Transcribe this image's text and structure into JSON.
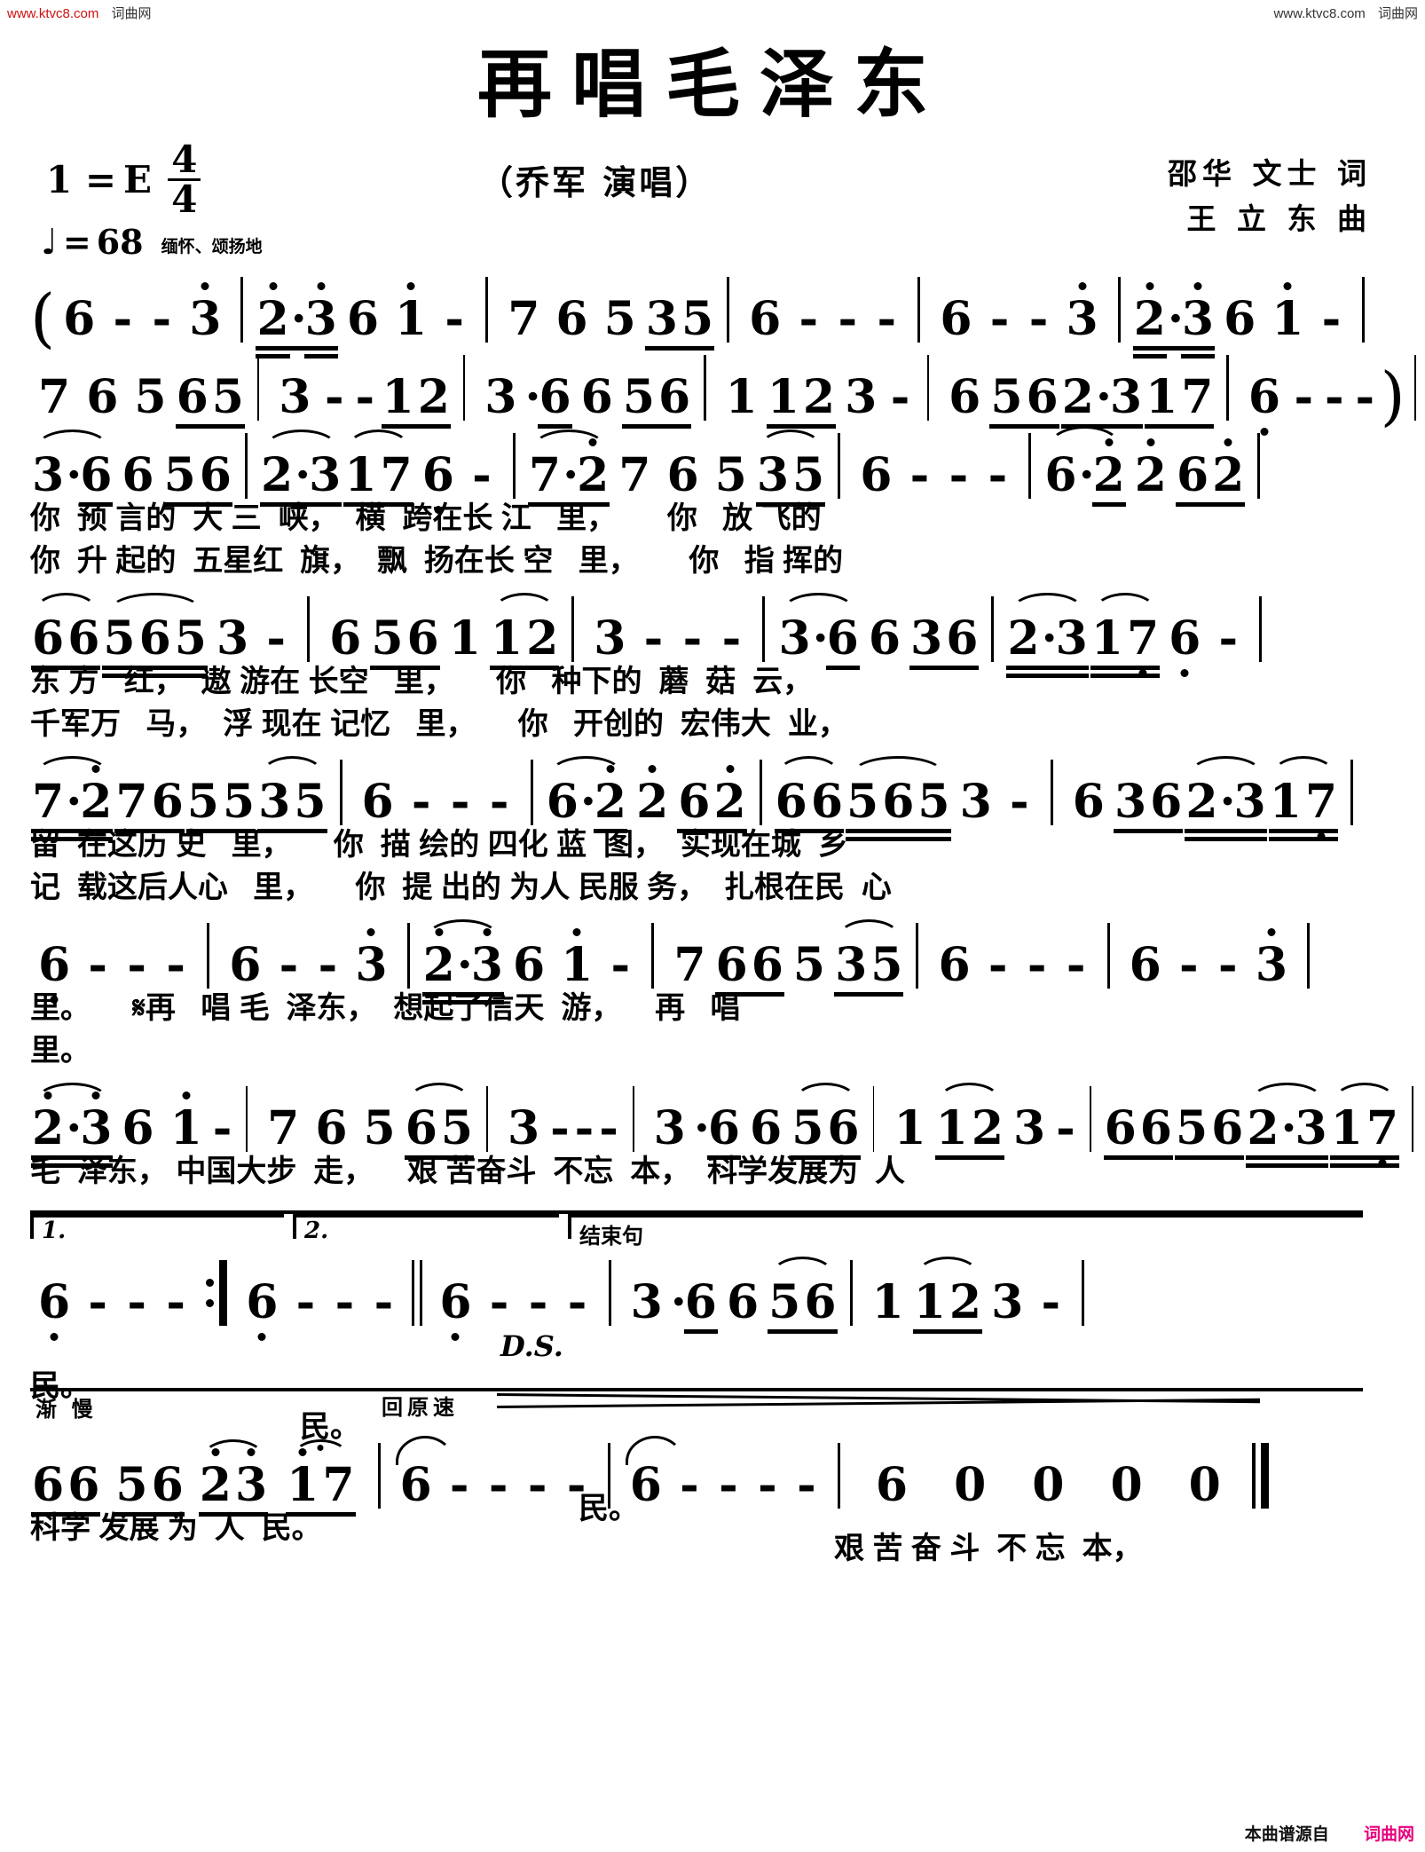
{
  "watermark": {
    "left_url": "www.ktvc8.com",
    "left_site": "词曲网",
    "right_url": "www.ktvc8.com",
    "right_site": "词曲网"
  },
  "footer": {
    "source_label": "本曲谱源自",
    "source_site": "词曲网"
  },
  "header": {
    "title": "再唱毛泽东",
    "key_label": "1 =",
    "key_value": "E",
    "time_numerator": "4",
    "time_denominator": "4",
    "tempo_note": "♩",
    "tempo_eq": "=",
    "tempo_value": "68",
    "mood": "缅怀、颂扬地",
    "singer": "（乔军 演唱）",
    "lyricist": "邵华 文士 词",
    "composer": "王 立 东 曲"
  },
  "directions": {
    "segno": "𝄋",
    "ds": "D.S.",
    "volta1": "1.",
    "volta2": "2.",
    "coda_label": "结束句",
    "rit": "渐 慢",
    "a_tempo": "回原速"
  },
  "systems": [
    {
      "id": "system-1",
      "notes": "( 6 - - 3̇ | 2̇·3̇ 6 1̇ - | 7 6 5 35 | 6 - - - | 6 - - 3̇ | 2̇·3̇ 6 1̇ - |",
      "lyrics": []
    },
    {
      "id": "system-2",
      "notes": "7 6 5 65 | 3 - - 12 | 3·6 6 56 | 1 12 3 - | 6 56 2·3 17 | 6̣ - - - )",
      "lyrics": []
    },
    {
      "id": "system-3",
      "notes": "3·6 6 56 | 2·3 17 6 - | 7·2̇ 7 6 5 35 | 6 - - - | 6·2̇ 2̇ 6 2̇ |",
      "lyrics": [
        "你  预 言的  大 三  峡，  横  跨在长 江   里，      你   放 飞的",
        "你  升 起的  五星红  旗，  飘  扬在长 空   里，      你   指 挥的"
      ]
    },
    {
      "id": "system-4",
      "notes": "66 565 3 - | 6 56 1 12 | 3 - - - | 3·6 6 36 | 2·3 17 6 - |",
      "lyrics": [
        "东 方   红，  遨 游在 长空   里，     你   种下的  蘑  菇  云，",
        "千军万   马，  浮 现在 记忆   里，     你   开创的  宏伟大  业，"
      ]
    },
    {
      "id": "system-5",
      "notes": "7·2̇ 76 55 35 | 6 - - - | 6·2̇ 2̇ 6 2̇ | 66 565 3 - | 6 36 2·3 17 |",
      "lyrics": [
        "留  在这历 史   里，     你  描 绘的 四化 蓝  图，  实现在城  乡",
        "记  载这后人心   里，     你  提 出的 为人 民服 务，  扎根在民  心"
      ]
    },
    {
      "id": "system-6",
      "notes": "6̣ - - - | 6 - - 3̇ | 2̇·3̇ 6 1̇ - | 7 66 5 35 | 6 - - - | 6 - - 3̇ |",
      "lyrics": [
        "里。     𝄋再   唱 毛  泽东，  想起了信天  游，    再   唱",
        "里。"
      ]
    },
    {
      "id": "system-7",
      "notes": "2̇·3̇ 6 1̇ - | 7 6 5 65 | 3 - - - | 3·6 6 56 | 1 12 3 - | 66 56 2·3 17 |",
      "lyrics": [
        "毛  泽东， 中国大步  走，    艰 苦奋斗  不忘  本，  科学发展为  人"
      ]
    },
    {
      "id": "system-8",
      "notes": "6̣ - - - :|| 6̣ - - - || 6̣ - - - | 3·6 6 56 | 1 12 3 - |",
      "lyrics": [
        "民。         民。          民。      艰 苦 奋 斗  不 忘  本，"
      ]
    },
    {
      "id": "system-9",
      "notes": "66 56 2̇3̇ 1̇7 | 6 - - - | 6 - - - | 6 0 0 0 ||",
      "lyrics": [
        "科学 发展 为  人  民。"
      ]
    }
  ]
}
